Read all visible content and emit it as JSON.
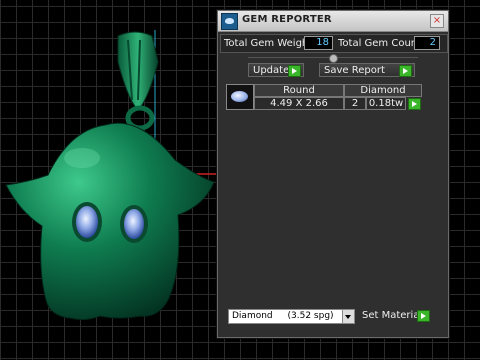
{
  "panel": {
    "title": "GEM REPORTER",
    "close_symbol": "×",
    "total_gem_weight_label": "Total Gem Weight",
    "total_gem_weight_value": "18",
    "total_gem_count_label": "Total Gem Count",
    "total_gem_count_value": "2",
    "update_label": "Update",
    "save_report_label": "Save Report",
    "table": {
      "headers": [
        "Round",
        "Diamond"
      ],
      "rows": [
        {
          "size": "4.49 X 2.66",
          "count": "2",
          "weight": "0.18tw"
        }
      ]
    },
    "material": {
      "name": "Diamond",
      "spg": "(3.52 spg)"
    },
    "set_material_label": "Set Material"
  },
  "colors": {
    "model_green": "#0d6b46",
    "value_text": "#66ccff",
    "go_button": "#3bb52a"
  },
  "icons": [
    "gem-reporter-app-icon",
    "close-icon",
    "go-arrow-icon",
    "gem-thumbnail-icon",
    "dropdown-arrow-icon"
  ]
}
